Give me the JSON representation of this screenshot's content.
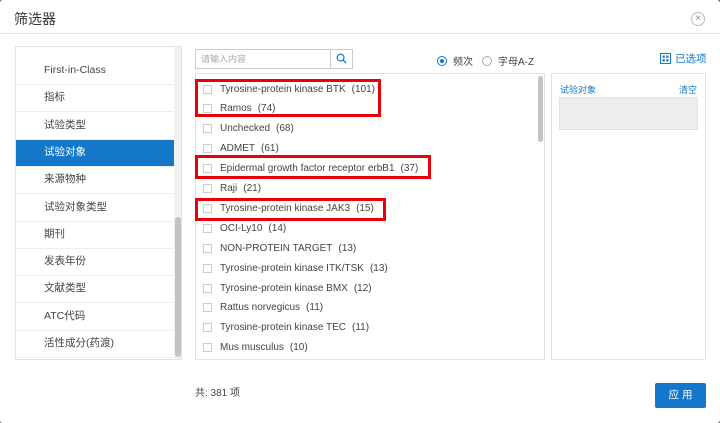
{
  "dialog": {
    "title": "筛选器",
    "close_glyph": "×"
  },
  "categories": [
    {
      "label": "First-in-Class",
      "active": false
    },
    {
      "label": "指标",
      "active": false
    },
    {
      "label": "试验类型",
      "active": false
    },
    {
      "label": "试验对象",
      "active": true
    },
    {
      "label": "来源物种",
      "active": false
    },
    {
      "label": "试验对象类型",
      "active": false
    },
    {
      "label": "期刊",
      "active": false
    },
    {
      "label": "发表年份",
      "active": false
    },
    {
      "label": "文献类型",
      "active": false
    },
    {
      "label": "ATC代码",
      "active": false
    },
    {
      "label": "活性成分(药渡)",
      "active": false
    }
  ],
  "search": {
    "placeholder": "请输入内容",
    "value": "",
    "icon": "search-icon"
  },
  "sort": {
    "options": [
      "频次",
      "字母A-Z"
    ],
    "selected": "频次"
  },
  "selected_link": {
    "label": "已选项",
    "icon": "grid-icon"
  },
  "options": [
    {
      "label": "Tyrosine-protein kinase BTK",
      "count": "(101)",
      "highlighted": true
    },
    {
      "label": "Ramos",
      "count": "(74)",
      "highlighted": true
    },
    {
      "label": "Unchecked",
      "count": "(68)",
      "highlighted": false
    },
    {
      "label": "ADMET",
      "count": "(61)",
      "highlighted": false
    },
    {
      "label": "Epidermal growth factor receptor erbB1",
      "count": "(37)",
      "highlighted": true
    },
    {
      "label": "Raji",
      "count": "(21)",
      "highlighted": false
    },
    {
      "label": "Tyrosine-protein kinase JAK3",
      "count": "(15)",
      "highlighted": true
    },
    {
      "label": "OCI-Ly10",
      "count": "(14)",
      "highlighted": false
    },
    {
      "label": "NON-PROTEIN TARGET",
      "count": "(13)",
      "highlighted": false
    },
    {
      "label": "Tyrosine-protein kinase ITK/TSK",
      "count": "(13)",
      "highlighted": false
    },
    {
      "label": "Tyrosine-protein kinase BMX",
      "count": "(12)",
      "highlighted": false
    },
    {
      "label": "Rattus norvegicus",
      "count": "(11)",
      "highlighted": false
    },
    {
      "label": "Tyrosine-protein kinase TEC",
      "count": "(11)",
      "highlighted": false
    },
    {
      "label": "Mus musculus",
      "count": "(10)",
      "highlighted": false
    }
  ],
  "selected_panel": {
    "heading": "试验对象",
    "clear_label": "清空"
  },
  "footer": {
    "total": "共: 381 项",
    "apply_label": "应 用"
  },
  "colors": {
    "accent": "#1477c9",
    "annotation": "#e8000b"
  }
}
